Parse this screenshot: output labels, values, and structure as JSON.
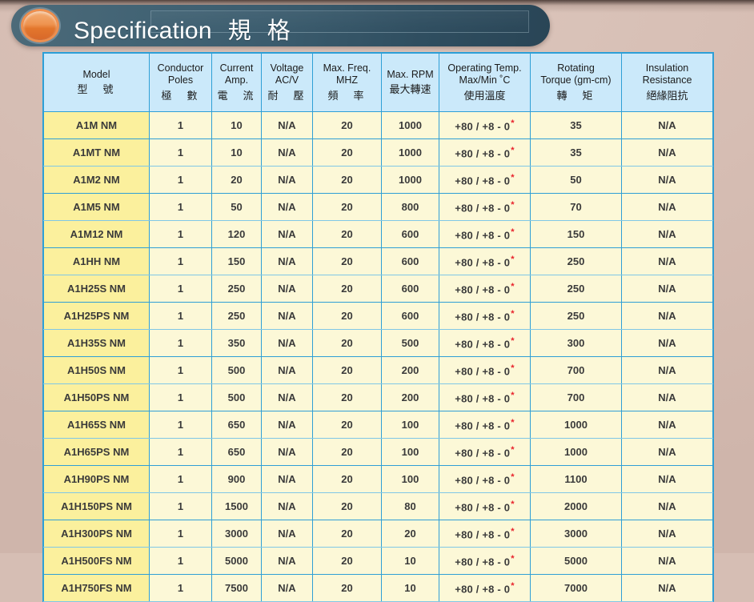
{
  "banner": {
    "icon": "orange-ellipse-icon",
    "title_en": "Specification",
    "title_cjk": "規 格"
  },
  "colors": {
    "background": "#d6beb4",
    "banner_dark": "#2f4e60",
    "banner_light": "#4c6a79",
    "icon_orange": "#ef9450",
    "header_cell": "#cbe9fa",
    "model_cell": "#fbf09d",
    "data_cell": "#fcf8d7",
    "border_blue": "#2f9fd6",
    "model_text": "#2a2a8c",
    "asterisk_red": "#e8202a"
  },
  "table": {
    "columns": [
      {
        "en": "Model",
        "en2": "",
        "cjk": "型　號",
        "key": "model"
      },
      {
        "en": "Conductor",
        "en2": "Poles",
        "cjk": "極　數",
        "key": "poles"
      },
      {
        "en": "Current",
        "en2": "Amp.",
        "cjk": "電　流",
        "key": "amp"
      },
      {
        "en": "Voltage",
        "en2": "AC/V",
        "cjk": "耐　壓",
        "key": "voltage"
      },
      {
        "en": "Max. Freq.",
        "en2": "MHZ",
        "cjk": "頻　率",
        "key": "freq"
      },
      {
        "en": "Max. RPM",
        "en2": "",
        "cjk": "最大轉速",
        "key": "rpm"
      },
      {
        "en": "Operating Temp.",
        "en2": "Max/Min ˚C",
        "cjk": "使用溫度",
        "key": "temp"
      },
      {
        "en": "Rotating",
        "en2": "Torque (gm-cm)",
        "cjk": "轉　矩",
        "key": "torque"
      },
      {
        "en": "Insulation",
        "en2": "Resistance",
        "cjk": "絕緣阻抗",
        "key": "insulation"
      }
    ],
    "temp_value": "+80 / +8 - 0",
    "temp_footnote_marker": "*",
    "rows": [
      {
        "model": "A1M NM",
        "poles": "1",
        "amp": "10",
        "voltage": "N/A",
        "freq": "20",
        "rpm": "1000",
        "temp": "+80 / +8 - 0",
        "torque": "35",
        "insulation": "N/A"
      },
      {
        "model": "A1MT NM",
        "poles": "1",
        "amp": "10",
        "voltage": "N/A",
        "freq": "20",
        "rpm": "1000",
        "temp": "+80 / +8 - 0",
        "torque": "35",
        "insulation": "N/A"
      },
      {
        "model": "A1M2 NM",
        "poles": "1",
        "amp": "20",
        "voltage": "N/A",
        "freq": "20",
        "rpm": "1000",
        "temp": "+80 / +8 - 0",
        "torque": "50",
        "insulation": "N/A"
      },
      {
        "model": "A1M5 NM",
        "poles": "1",
        "amp": "50",
        "voltage": "N/A",
        "freq": "20",
        "rpm": "800",
        "temp": "+80 / +8 - 0",
        "torque": "70",
        "insulation": "N/A"
      },
      {
        "model": "A1M12 NM",
        "poles": "1",
        "amp": "120",
        "voltage": "N/A",
        "freq": "20",
        "rpm": "600",
        "temp": "+80 / +8 - 0",
        "torque": "150",
        "insulation": "N/A"
      },
      {
        "model": "A1HH NM",
        "poles": "1",
        "amp": "150",
        "voltage": "N/A",
        "freq": "20",
        "rpm": "600",
        "temp": "+80 / +8 - 0",
        "torque": "250",
        "insulation": "N/A"
      },
      {
        "model": "A1H25S NM",
        "poles": "1",
        "amp": "250",
        "voltage": "N/A",
        "freq": "20",
        "rpm": "600",
        "temp": "+80 / +8 - 0",
        "torque": "250",
        "insulation": "N/A"
      },
      {
        "model": "A1H25PS NM",
        "poles": "1",
        "amp": "250",
        "voltage": "N/A",
        "freq": "20",
        "rpm": "600",
        "temp": "+80 / +8 - 0",
        "torque": "250",
        "insulation": "N/A"
      },
      {
        "model": "A1H35S NM",
        "poles": "1",
        "amp": "350",
        "voltage": "N/A",
        "freq": "20",
        "rpm": "500",
        "temp": "+80 / +8 - 0",
        "torque": "300",
        "insulation": "N/A"
      },
      {
        "model": "A1H50S NM",
        "poles": "1",
        "amp": "500",
        "voltage": "N/A",
        "freq": "20",
        "rpm": "200",
        "temp": "+80 / +8 - 0",
        "torque": "700",
        "insulation": "N/A"
      },
      {
        "model": "A1H50PS NM",
        "poles": "1",
        "amp": "500",
        "voltage": "N/A",
        "freq": "20",
        "rpm": "200",
        "temp": "+80 / +8 - 0",
        "torque": "700",
        "insulation": "N/A"
      },
      {
        "model": "A1H65S NM",
        "poles": "1",
        "amp": "650",
        "voltage": "N/A",
        "freq": "20",
        "rpm": "100",
        "temp": "+80 / +8 - 0",
        "torque": "1000",
        "insulation": "N/A"
      },
      {
        "model": "A1H65PS NM",
        "poles": "1",
        "amp": "650",
        "voltage": "N/A",
        "freq": "20",
        "rpm": "100",
        "temp": "+80 / +8 - 0",
        "torque": "1000",
        "insulation": "N/A"
      },
      {
        "model": "A1H90PS NM",
        "poles": "1",
        "amp": "900",
        "voltage": "N/A",
        "freq": "20",
        "rpm": "100",
        "temp": "+80 / +8 - 0",
        "torque": "1100",
        "insulation": "N/A"
      },
      {
        "model": "A1H150PS NM",
        "poles": "1",
        "amp": "1500",
        "voltage": "N/A",
        "freq": "20",
        "rpm": "80",
        "temp": "+80 / +8 - 0",
        "torque": "2000",
        "insulation": "N/A"
      },
      {
        "model": "A1H300PS NM",
        "poles": "1",
        "amp": "3000",
        "voltage": "N/A",
        "freq": "20",
        "rpm": "20",
        "temp": "+80 / +8 - 0",
        "torque": "3000",
        "insulation": "N/A"
      },
      {
        "model": "A1H500FS NM",
        "poles": "1",
        "amp": "5000",
        "voltage": "N/A",
        "freq": "20",
        "rpm": "10",
        "temp": "+80 / +8 - 0",
        "torque": "5000",
        "insulation": "N/A"
      },
      {
        "model": "A1H750FS NM",
        "poles": "1",
        "amp": "7500",
        "voltage": "N/A",
        "freq": "20",
        "rpm": "10",
        "temp": "+80 / +8 - 0",
        "torque": "7000",
        "insulation": "N/A"
      }
    ]
  }
}
